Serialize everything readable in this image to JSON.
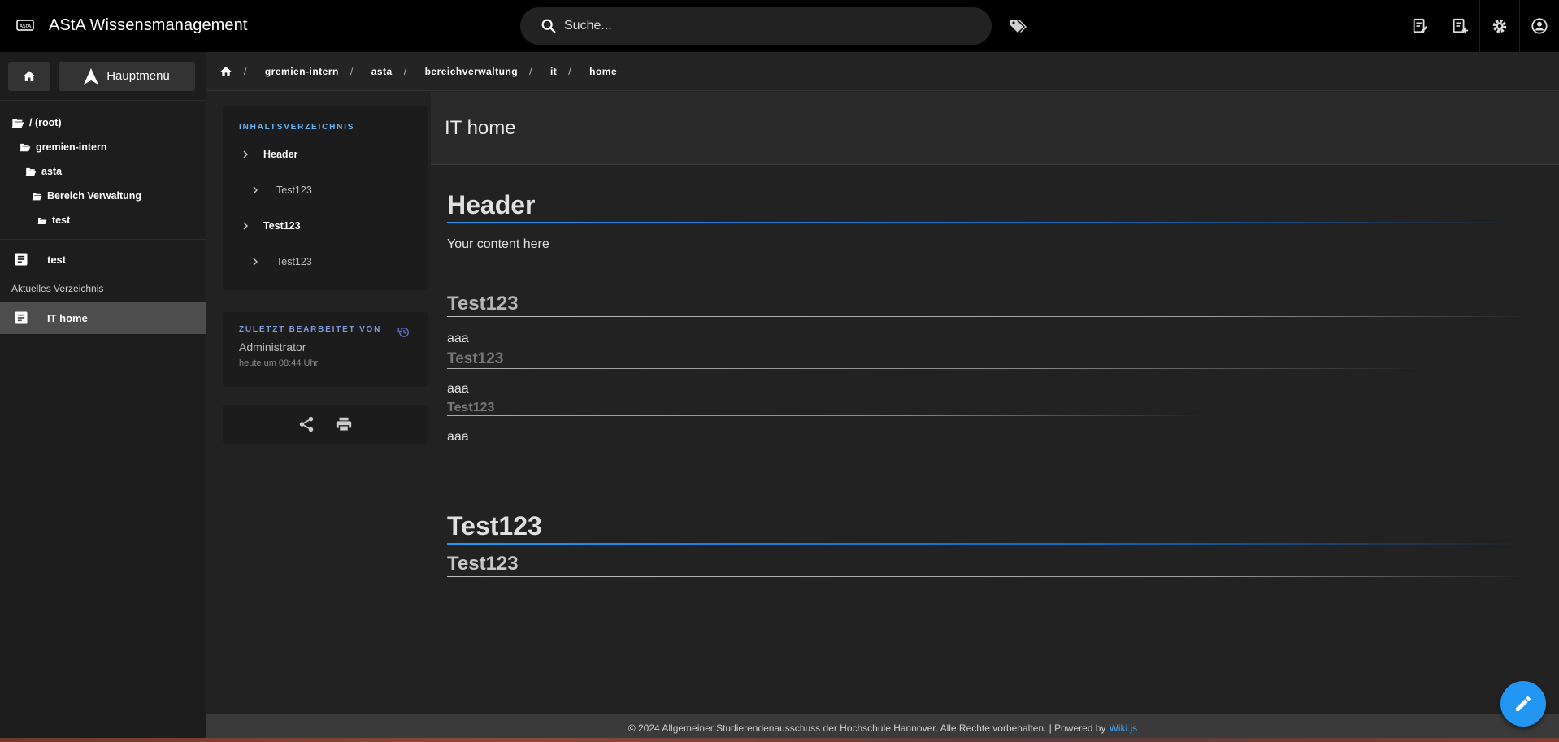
{
  "header": {
    "title": "AStA Wissensmanagement",
    "search_placeholder": "Suche...",
    "icons": [
      "logo-icon",
      "search-icon",
      "tags-icon",
      "edit-page-icon",
      "new-page-icon",
      "settings-icon",
      "account-icon"
    ]
  },
  "sidebar": {
    "home_icon": "home-icon",
    "menu_label": "Hauptmenü",
    "tree": [
      {
        "label": "/ (root)",
        "level": 0
      },
      {
        "label": "gremien-intern",
        "level": 1
      },
      {
        "label": "asta",
        "level": 2
      },
      {
        "label": "Bereich Verwaltung",
        "level": 3
      },
      {
        "label": "test",
        "level": 4
      }
    ],
    "pages": [
      {
        "label": "test"
      }
    ],
    "current_dir_label": "Aktuelles Verzeichnis",
    "current_pages": [
      {
        "label": "IT home",
        "active": true
      }
    ]
  },
  "breadcrumb": [
    "gremien-intern",
    "asta",
    "bereichverwaltung",
    "it",
    "home"
  ],
  "toc": {
    "heading": "INHALTSVERZEICHNIS",
    "items": [
      {
        "label": "Header",
        "level": 1
      },
      {
        "label": "Test123",
        "level": 2
      },
      {
        "label": "Test123",
        "level": 1
      },
      {
        "label": "Test123",
        "level": 2
      }
    ]
  },
  "last_edit": {
    "heading": "ZULETZT BEARBEITET VON",
    "name": "Administrator",
    "date": "heute um 08:44 Uhr"
  },
  "page": {
    "title": "IT home",
    "blocks": [
      {
        "type": "h1",
        "text": "Header"
      },
      {
        "type": "p",
        "text": "Your content here"
      },
      {
        "type": "h2",
        "text": "Test123"
      },
      {
        "type": "p",
        "text": "aaa"
      },
      {
        "type": "h3",
        "text": "Test123"
      },
      {
        "type": "p",
        "text": "aaa"
      },
      {
        "type": "h4",
        "text": "Test123"
      },
      {
        "type": "p",
        "text": "aaa"
      },
      {
        "type": "h1",
        "text": "Test123"
      },
      {
        "type": "h2",
        "text": "Test123"
      }
    ]
  },
  "footer": {
    "text": "© 2024 Allgemeiner Studierendenausschuss der Hochschule Hannover. Alle Rechte vorbehalten. | Powered by",
    "link": "Wiki.js"
  },
  "colors": {
    "accent": "#2196f3",
    "topbar": "#000000",
    "sidebar": "#1d1d1d"
  }
}
